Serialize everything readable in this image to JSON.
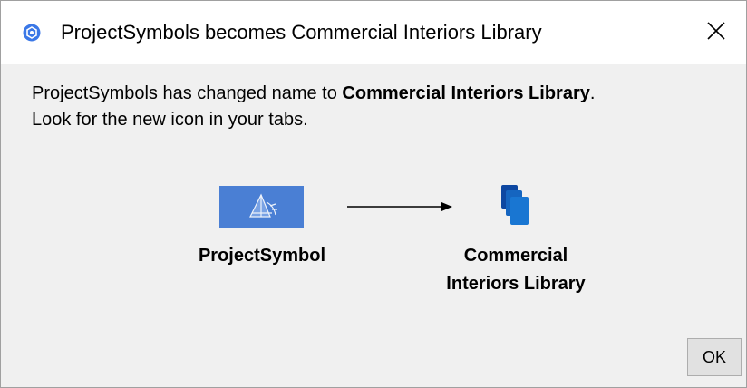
{
  "window": {
    "title": "ProjectSymbols becomes Commercial Interiors Library",
    "app_icon": "hexagon-logo-icon",
    "close_icon": "close-icon",
    "accent_color": "#3b78e7"
  },
  "message": {
    "line1_prefix": "ProjectSymbols has changed name to ",
    "line1_bold": "Commercial Interiors Library",
    "line1_suffix": ".",
    "line2": "Look for the new icon in your tabs."
  },
  "transition": {
    "old_icon": "projectsymbol-tab-icon",
    "old_icon_color": "#4a7fd4",
    "arrow_icon": "right-arrow-icon",
    "new_icon": "stacked-documents-icon",
    "new_icon_color": "#1565c0",
    "old_label": "ProjectSymbol",
    "new_label_line1": "Commercial",
    "new_label_line2": "Interiors Library"
  },
  "buttons": {
    "ok_label": "OK"
  }
}
